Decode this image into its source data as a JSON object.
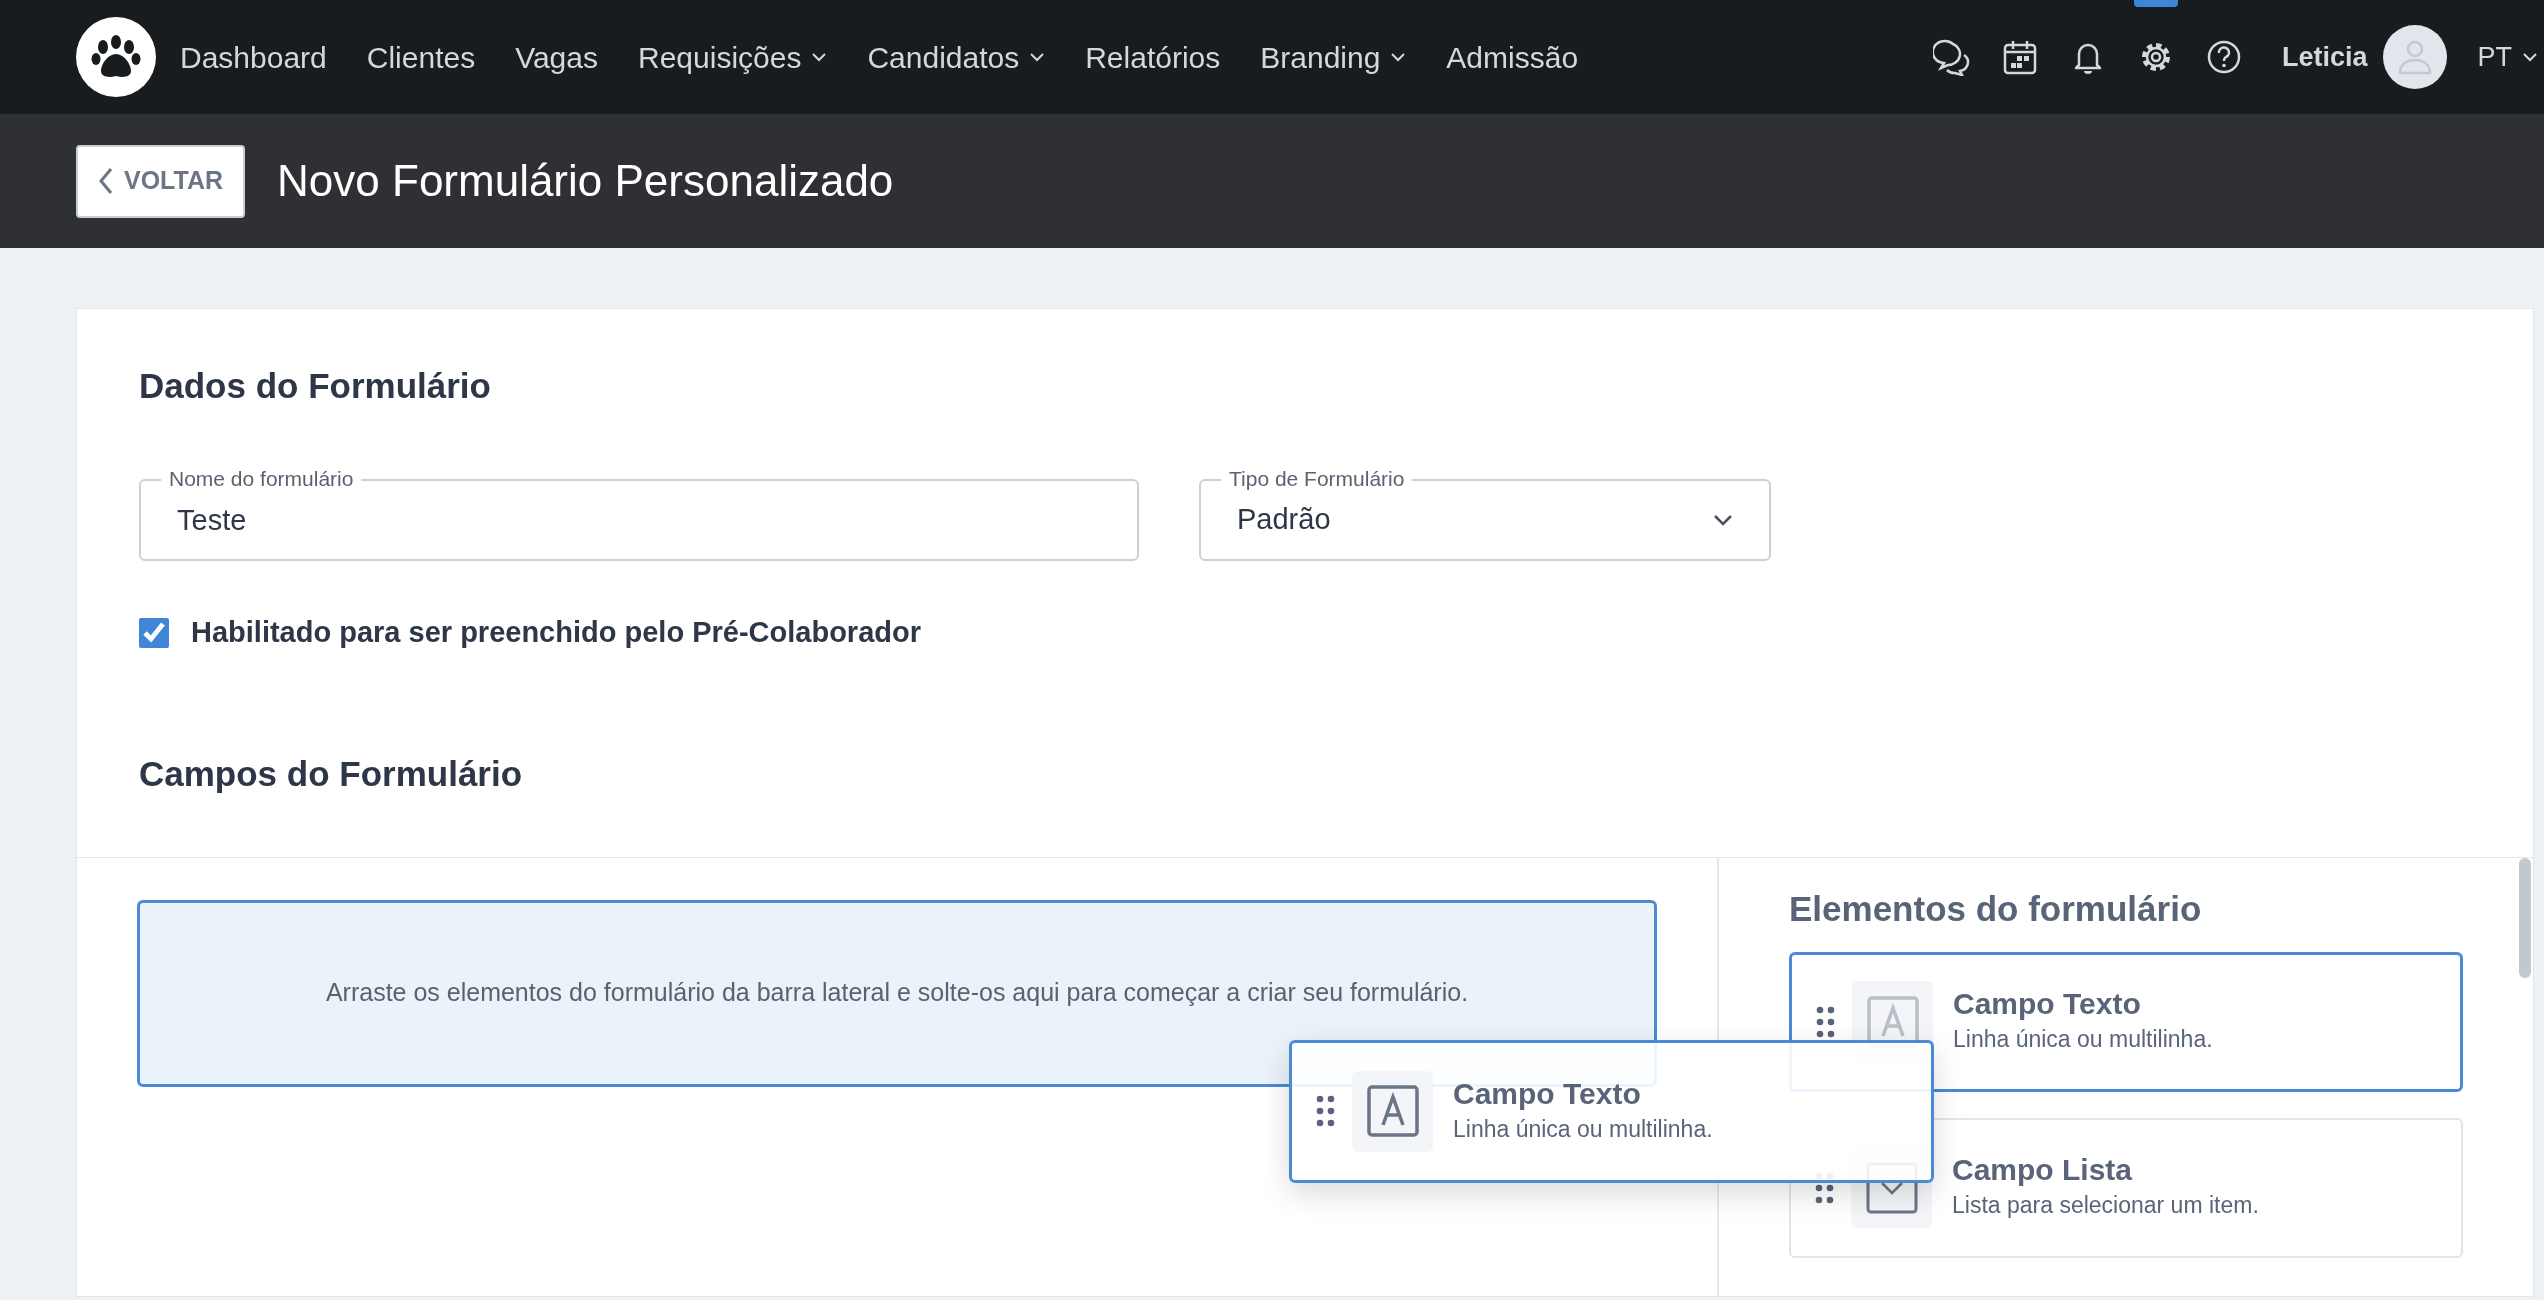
{
  "navbar": {
    "menu": [
      {
        "label": "Dashboard",
        "dropdown": false
      },
      {
        "label": "Clientes",
        "dropdown": false
      },
      {
        "label": "Vagas",
        "dropdown": false
      },
      {
        "label": "Requisições",
        "dropdown": true
      },
      {
        "label": "Candidatos",
        "dropdown": true
      },
      {
        "label": "Relatórios",
        "dropdown": false
      },
      {
        "label": "Branding",
        "dropdown": true
      },
      {
        "label": "Admissão",
        "dropdown": false
      }
    ],
    "icons": [
      {
        "kind": "chat",
        "selected": false
      },
      {
        "kind": "calendar",
        "selected": false
      },
      {
        "kind": "bell",
        "selected": false
      },
      {
        "kind": "settings",
        "selected": true
      },
      {
        "kind": "help",
        "selected": false
      }
    ],
    "user": {
      "name": "Leticia"
    },
    "language": {
      "label": "PT"
    }
  },
  "header": {
    "back_button": "VOLTAR",
    "title": "Novo Formulário Personalizado"
  },
  "form_data": {
    "heading": "Dados do Formulário",
    "name_field": {
      "label": "Nome do formulário",
      "value": "Teste"
    },
    "type_field": {
      "label": "Tipo de Formulário",
      "value": "Padrão"
    },
    "pre_collaborator": {
      "label": "Habilitado para ser preenchido pelo Pré-Colaborador",
      "checked": true
    }
  },
  "fields_heading": "Campos do Formulário",
  "drop_zone": {
    "text": "Arraste os elementos do formulário da barra lateral e solte-os aqui para começar a criar seu formulário."
  },
  "sidebar": {
    "title": "Elementos do formulário",
    "elements": [
      {
        "kind": "text",
        "title": "Campo Texto",
        "description": "Linha única ou multilinha.",
        "selected": true
      },
      {
        "kind": "list",
        "title": "Campo Lista",
        "description": "Lista para selecionar um item.",
        "selected": false
      }
    ]
  },
  "drag_ghost": {
    "kind": "text",
    "title": "Campo Texto",
    "description": "Linha única ou multilinha."
  }
}
